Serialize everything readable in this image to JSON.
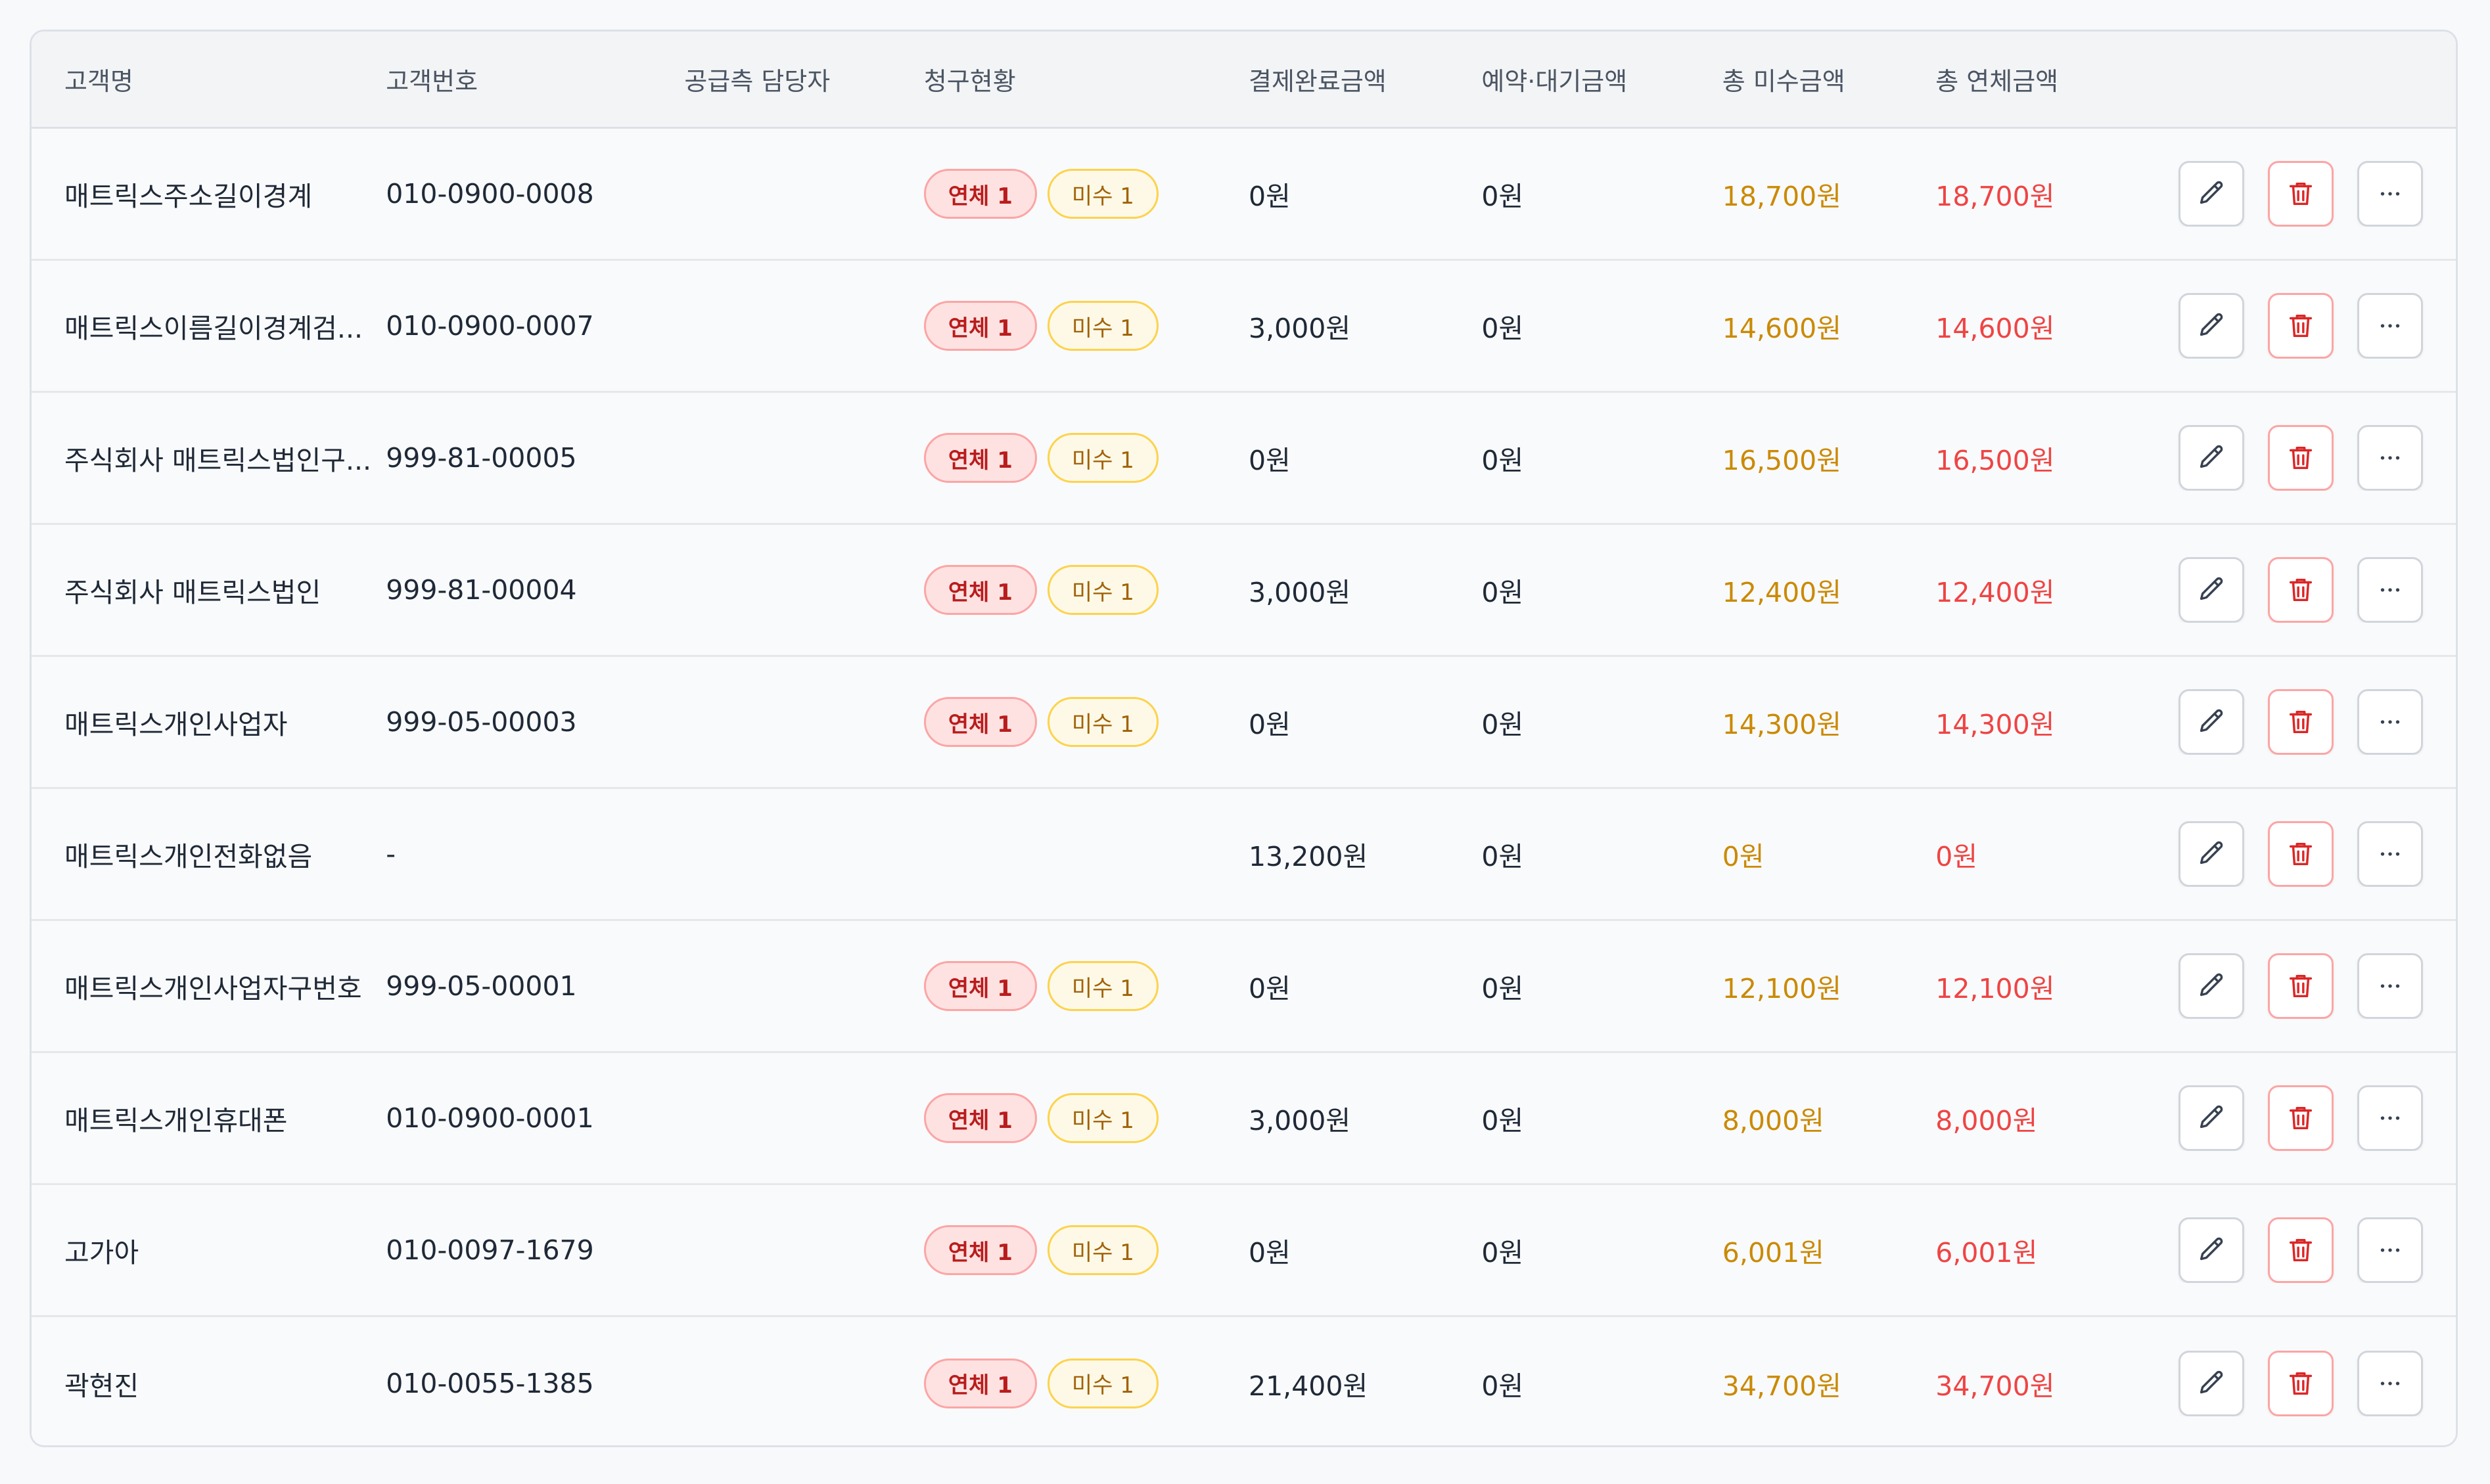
{
  "colors": {
    "unpaid_amount": "#ca8a04",
    "overdue_amount": "#ef4444",
    "badge_overdue_bg": "#fee2e2",
    "badge_unpaid_bg": "#fef9e7"
  },
  "table": {
    "headers": {
      "name": "고객명",
      "number": "고객번호",
      "manager": "공급측 담당자",
      "status": "청구현황",
      "paid": "결제완료금액",
      "reserve": "예약·대기금액",
      "unpaid": "총 미수금액",
      "overdue": "총 연체금액"
    },
    "rows": [
      {
        "name": "매트릭스주소길이경계",
        "number": "010-0900-0008",
        "manager": "",
        "overdue_badge": "연체 1",
        "unpaid_badge": "미수 1",
        "paid": "0원",
        "reserve": "0원",
        "unpaid": "18,700원",
        "overdue": "18,700원"
      },
      {
        "name": "매트릭스이름길이경계검...",
        "number": "010-0900-0007",
        "manager": "",
        "overdue_badge": "연체 1",
        "unpaid_badge": "미수 1",
        "paid": "3,000원",
        "reserve": "0원",
        "unpaid": "14,600원",
        "overdue": "14,600원"
      },
      {
        "name": "주식회사 매트릭스법인구...",
        "number": "999-81-00005",
        "manager": "",
        "overdue_badge": "연체 1",
        "unpaid_badge": "미수 1",
        "paid": "0원",
        "reserve": "0원",
        "unpaid": "16,500원",
        "overdue": "16,500원"
      },
      {
        "name": "주식회사 매트릭스법인",
        "number": "999-81-00004",
        "manager": "",
        "overdue_badge": "연체 1",
        "unpaid_badge": "미수 1",
        "paid": "3,000원",
        "reserve": "0원",
        "unpaid": "12,400원",
        "overdue": "12,400원"
      },
      {
        "name": "매트릭스개인사업자",
        "number": "999-05-00003",
        "manager": "",
        "overdue_badge": "연체 1",
        "unpaid_badge": "미수 1",
        "paid": "0원",
        "reserve": "0원",
        "unpaid": "14,300원",
        "overdue": "14,300원"
      },
      {
        "name": "매트릭스개인전화없음",
        "number": "-",
        "manager": "",
        "overdue_badge": "",
        "unpaid_badge": "",
        "paid": "13,200원",
        "reserve": "0원",
        "unpaid": "0원",
        "overdue": "0원"
      },
      {
        "name": "매트릭스개인사업자구번호",
        "number": "999-05-00001",
        "manager": "",
        "overdue_badge": "연체 1",
        "unpaid_badge": "미수 1",
        "paid": "0원",
        "reserve": "0원",
        "unpaid": "12,100원",
        "overdue": "12,100원"
      },
      {
        "name": "매트릭스개인휴대폰",
        "number": "010-0900-0001",
        "manager": "",
        "overdue_badge": "연체 1",
        "unpaid_badge": "미수 1",
        "paid": "3,000원",
        "reserve": "0원",
        "unpaid": "8,000원",
        "overdue": "8,000원"
      },
      {
        "name": "고가아",
        "number": "010-0097-1679",
        "manager": "",
        "overdue_badge": "연체 1",
        "unpaid_badge": "미수 1",
        "paid": "0원",
        "reserve": "0원",
        "unpaid": "6,001원",
        "overdue": "6,001원"
      },
      {
        "name": "곽현진",
        "number": "010-0055-1385",
        "manager": "",
        "overdue_badge": "연체 1",
        "unpaid_badge": "미수 1",
        "paid": "21,400원",
        "reserve": "0원",
        "unpaid": "34,700원",
        "overdue": "34,700원"
      }
    ],
    "row_actions": {
      "edit_icon": "pencil-icon",
      "delete_icon": "trash-icon",
      "more_icon": "more-horizontal-icon"
    }
  }
}
